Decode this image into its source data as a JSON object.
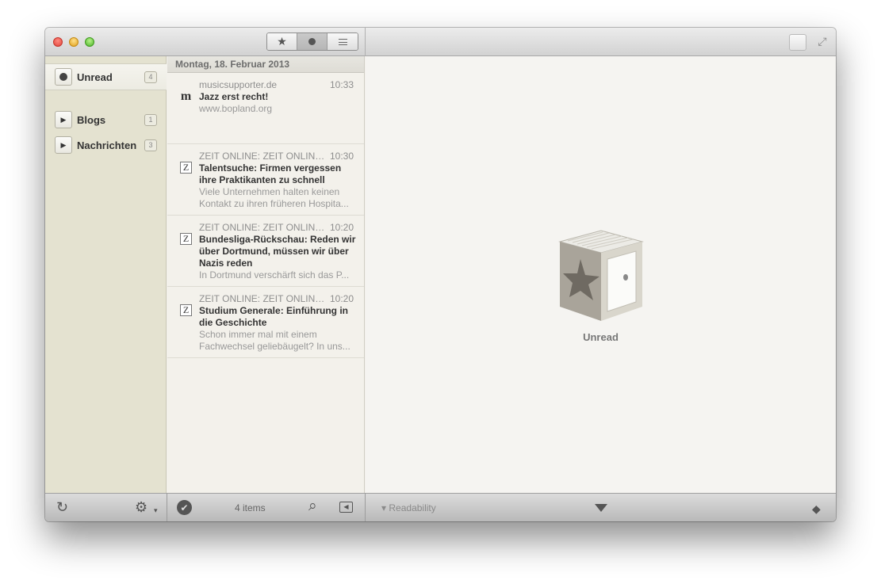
{
  "toolbar": {
    "segments": [
      {
        "name": "starred",
        "icon": "star-icon",
        "glyph": "★"
      },
      {
        "name": "unread",
        "icon": "dot-icon"
      },
      {
        "name": "all",
        "icon": "lines-icon"
      }
    ],
    "fullscreen_glyph": "⤢"
  },
  "sidebar": {
    "items": [
      {
        "label": "Unread",
        "count": "4",
        "icon": "dot-icon"
      },
      {
        "label": "Blogs",
        "count": "1",
        "icon": "disclosure-triangle-icon",
        "glyph": "▶"
      },
      {
        "label": "Nachrichten",
        "count": "3",
        "icon": "disclosure-triangle-icon",
        "glyph": "▶"
      }
    ]
  },
  "list": {
    "date_header": "Montag, 18. Februar 2013",
    "articles": [
      {
        "icon_glyph": "m",
        "source": "musicsupporter.de",
        "time": "10:33",
        "title": "Jazz erst recht!",
        "summary": "www.bopland.org"
      },
      {
        "icon_glyph": "Z",
        "source": "ZEIT ONLINE: ZEIT ONLINE:...",
        "time": "10:30",
        "title": "Talentsuche: Firmen vergessen ihre Praktikanten zu schnell",
        "summary": "Viele Unternehmen halten keinen Kontakt zu ihren früheren Hospita..."
      },
      {
        "icon_glyph": "Z",
        "source": "ZEIT ONLINE: ZEIT ONLINE:...",
        "time": "10:20",
        "title": "Bundesliga-Rückschau: Reden wir über Dortmund, müssen wir über Nazis reden",
        "summary": "In Dortmund verschärft sich das P..."
      },
      {
        "icon_glyph": "Z",
        "source": "ZEIT ONLINE: ZEIT ONLINE:...",
        "time": "10:20",
        "title": "Studium Generale: Einführung in die Geschichte",
        "summary": "Schon immer mal mit einem Fachwechsel geliebäugelt? In uns..."
      }
    ]
  },
  "reader": {
    "empty_label": "Unread"
  },
  "bottombar": {
    "refresh_glyph": "↻",
    "settings_glyph": "⚙",
    "check_glyph": "✔",
    "items_count": "4 items",
    "search_glyph": "⌕",
    "back_glyph": "◀",
    "readability": "Readability",
    "readability_arrow": "▾",
    "cube_glyph": "◆"
  },
  "colors": {
    "sidebar_bg": "#e4e2d0",
    "list_bg": "#f3f1eb",
    "reader_bg": "#f5f4f1"
  }
}
